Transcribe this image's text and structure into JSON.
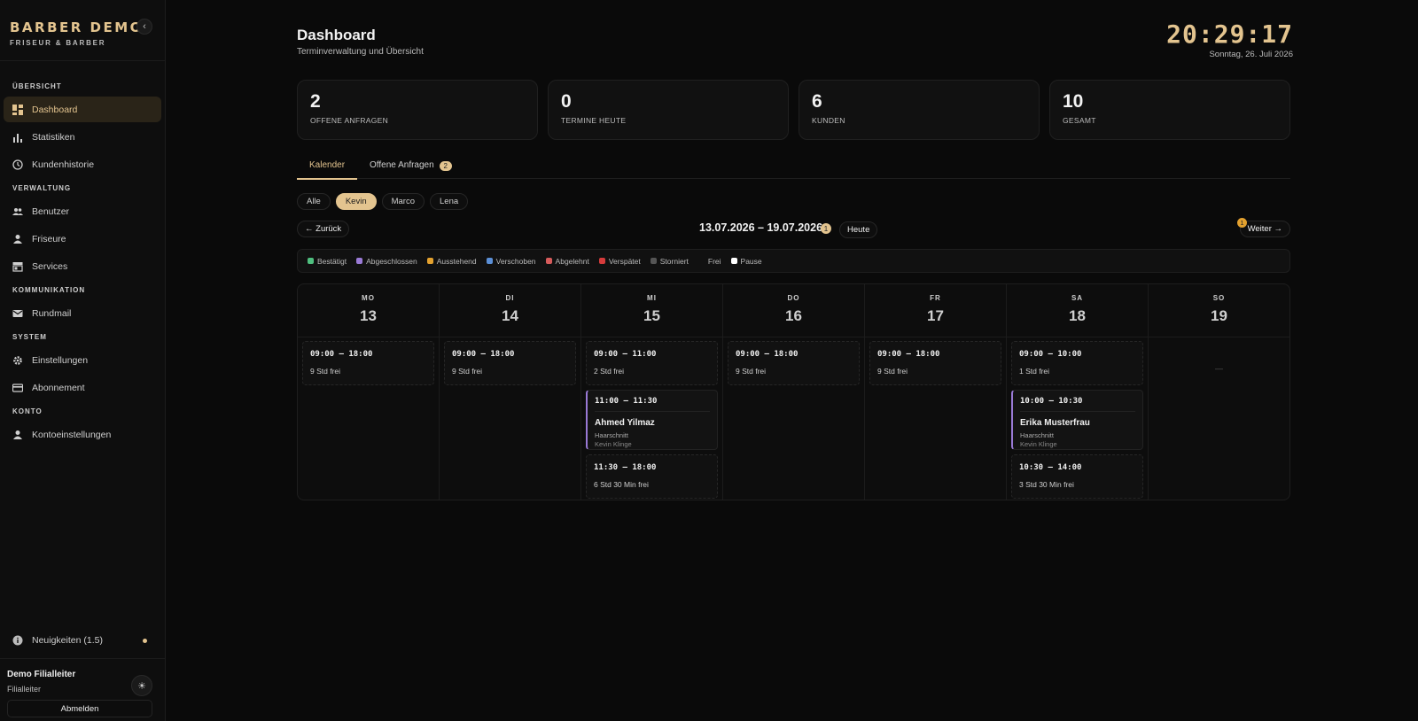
{
  "brand": {
    "title": "BARBER DEMO",
    "subtitle": "FRISEUR & BARBER",
    "collapse_icon": "‹"
  },
  "sidebar": {
    "sections": [
      {
        "title": "ÜBERSICHT",
        "items": [
          {
            "label": "Dashboard",
            "icon": "dashboard-icon",
            "active": true
          },
          {
            "label": "Statistiken",
            "icon": "bar-chart-icon"
          },
          {
            "label": "Kundenhistorie",
            "icon": "clock-icon"
          }
        ]
      },
      {
        "title": "VERWALTUNG",
        "items": [
          {
            "label": "Benutzer",
            "icon": "users-icon"
          },
          {
            "label": "Friseure",
            "icon": "user-icon"
          },
          {
            "label": "Services",
            "icon": "store-icon"
          }
        ]
      },
      {
        "title": "KOMMUNIKATION",
        "items": [
          {
            "label": "Rundmail",
            "icon": "mail-icon"
          }
        ]
      },
      {
        "title": "SYSTEM",
        "items": [
          {
            "label": "Einstellungen",
            "icon": "gear-icon"
          },
          {
            "label": "Abonnement",
            "icon": "card-icon"
          }
        ]
      },
      {
        "title": "KONTO",
        "items": [
          {
            "label": "Kontoeinstellungen",
            "icon": "user-icon"
          }
        ]
      }
    ],
    "news_label": "Neuigkeiten (1.5)",
    "user_name": "Demo Filialleiter",
    "user_role": "Filialleiter",
    "logout_label": "Abmelden",
    "theme_icon": "☀"
  },
  "header": {
    "title": "Dashboard",
    "subtitle": "Terminverwaltung und Übersicht",
    "clock": "20:29:17",
    "date": "Sonntag, 26. Juli 2026"
  },
  "stats": [
    {
      "value": "2",
      "label": "OFFENE ANFRAGEN"
    },
    {
      "value": "0",
      "label": "TERMINE HEUTE"
    },
    {
      "value": "6",
      "label": "KUNDEN"
    },
    {
      "value": "10",
      "label": "GESAMT"
    }
  ],
  "tabs": {
    "calendar": "Kalender",
    "requests": "Offene Anfragen",
    "requests_badge": "2"
  },
  "filters": [
    "Alle",
    "Kevin",
    "Marco",
    "Lena"
  ],
  "active_filter": "Kevin",
  "week_nav": {
    "back": "← Zurück",
    "range": "13.07.2026 – 19.07.2026",
    "range_badge": "1",
    "today": "Heute",
    "next": "Weiter →",
    "next_badge": "1"
  },
  "legend": [
    {
      "label": "Bestätigt",
      "color": "#4fbf7f"
    },
    {
      "label": "Abgeschlossen",
      "color": "#9a7ad6"
    },
    {
      "label": "Ausstehend",
      "color": "#e3a12f"
    },
    {
      "label": "Verschoben",
      "color": "#5b8fd6"
    },
    {
      "label": "Abgelehnt",
      "color": "#d65b5b"
    },
    {
      "label": "Verspätet",
      "color": "#d63b3b"
    },
    {
      "label": "Storniert",
      "color": "#555555"
    },
    {
      "label": "Frei",
      "color": "transparent"
    },
    {
      "label": "Pause",
      "color": "#ffffff"
    }
  ],
  "days": [
    {
      "name": "MO",
      "num": "13",
      "entries": [
        {
          "type": "free",
          "time": "09:00 – 18:00",
          "text": "9 Std frei"
        }
      ]
    },
    {
      "name": "DI",
      "num": "14",
      "entries": [
        {
          "type": "free",
          "time": "09:00 – 18:00",
          "text": "9 Std frei"
        }
      ]
    },
    {
      "name": "MI",
      "num": "15",
      "entries": [
        {
          "type": "free",
          "time": "09:00 – 11:00",
          "text": "2 Std frei"
        },
        {
          "type": "appt",
          "time": "11:00 – 11:30",
          "name": "Ahmed Yilmaz",
          "service": "Haarschnitt",
          "staff": "Kevin Klinge"
        },
        {
          "type": "free",
          "time": "11:30 – 18:00",
          "text": "6 Std 30 Min frei"
        }
      ]
    },
    {
      "name": "DO",
      "num": "16",
      "entries": [
        {
          "type": "free",
          "time": "09:00 – 18:00",
          "text": "9 Std frei"
        }
      ]
    },
    {
      "name": "FR",
      "num": "17",
      "entries": [
        {
          "type": "free",
          "time": "09:00 – 18:00",
          "text": "9 Std frei"
        }
      ]
    },
    {
      "name": "SA",
      "num": "18",
      "entries": [
        {
          "type": "free",
          "time": "09:00 – 10:00",
          "text": "1 Std frei"
        },
        {
          "type": "appt",
          "time": "10:00 – 10:30",
          "name": "Erika Musterfrau",
          "service": "Haarschnitt",
          "staff": "Kevin Klinge"
        },
        {
          "type": "free",
          "time": "10:30 – 14:00",
          "text": "3 Std 30 Min frei"
        }
      ]
    },
    {
      "name": "SO",
      "num": "19",
      "entries": [],
      "empty": "—"
    }
  ]
}
